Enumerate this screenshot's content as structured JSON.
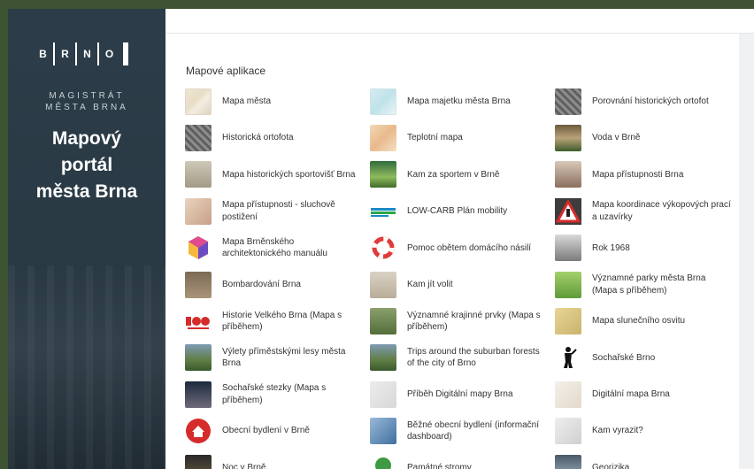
{
  "sidebar": {
    "logo_letters": [
      "B",
      "R",
      "N",
      "O"
    ],
    "magistrat_line1": "MAGISTRÁT",
    "magistrat_line2": "MĚSTA BRNA",
    "title_line1": "Mapový",
    "title_line2": "portál",
    "title_line3": "města Brna"
  },
  "main": {
    "section_title": "Mapové aplikace",
    "apps": [
      {
        "label": "Mapa města",
        "thumb": "map-thumb"
      },
      {
        "label": "Mapa majetku města Brna",
        "thumb": "map-thumb"
      },
      {
        "label": "Porovnání historických ortofot",
        "thumb": "ortho-thumb"
      },
      {
        "label": "Historická ortofota",
        "thumb": "ortho-thumb"
      },
      {
        "label": "Teplotní mapa",
        "thumb": "heat-map-thumb"
      },
      {
        "label": "Voda v Brně",
        "thumb": "water-thumb"
      },
      {
        "label": "Mapa historických sportovišť Brna",
        "thumb": "stadium-thumb"
      },
      {
        "label": "Kam za sportem v Brně",
        "thumb": "sport-thumb"
      },
      {
        "label": "Mapa přístupnosti Brna",
        "thumb": "person-thumb"
      },
      {
        "label": "Mapa přístupnosti - sluchově postižení",
        "thumb": "face-thumb"
      },
      {
        "label": "LOW-CARB Plán mobility",
        "thumb": "lowcarb-logo-thumb"
      },
      {
        "label": "Mapa koordinace výkopových prací a uzavírky",
        "thumb": "roadwork-sign-thumb"
      },
      {
        "label": "Mapa Brněnského architektonického manuálu",
        "thumb": "bam-hexagon-thumb"
      },
      {
        "label": "Pomoc obětem domácího násilí",
        "thumb": "lifebuoy-thumb"
      },
      {
        "label": "Rok 1968",
        "thumb": "old-photo-thumb"
      },
      {
        "label": "Bombardování Brna",
        "thumb": "ruins-thumb"
      },
      {
        "label": "Kam jít volit",
        "thumb": "ballot-thumb"
      },
      {
        "label": "Významné parky města Brna (Mapa s příběhem)",
        "thumb": "park-thumb"
      },
      {
        "label": "Historie Velkého Brna (Mapa s příběhem)",
        "thumb": "velke-brno-logo-thumb"
      },
      {
        "label": "Významné krajinné prvky (Mapa s příběhem)",
        "thumb": "river-thumb"
      },
      {
        "label": "Mapa slunečního osvitu",
        "thumb": "solar-thumb"
      },
      {
        "label": "Výlety příměstskými lesy města Brna",
        "thumb": "forest-thumb"
      },
      {
        "label": "Trips around the suburban forests of the city of Brno",
        "thumb": "forest-thumb"
      },
      {
        "label": "Sochařské Brno",
        "thumb": "statue-thumb"
      },
      {
        "label": "Sochařské stezky (Mapa s příběhem)",
        "thumb": "night-statue-thumb"
      },
      {
        "label": "Příběh Digitální mapy Brna",
        "thumb": "paper-map-thumb"
      },
      {
        "label": "Digitální mapa Brna",
        "thumb": "digital-map-thumb"
      },
      {
        "label": "Obecní bydlení v Brně",
        "thumb": "house-icon-thumb"
      },
      {
        "label": "Běžné obecní bydlení (informační dashboard)",
        "thumb": "dashboard-thumb"
      },
      {
        "label": "Kam vyrazit?",
        "thumb": "kam-vyrazit-thumb"
      },
      {
        "label": "Noc v Brně",
        "thumb": "night-thumb"
      },
      {
        "label": "Památné stromy",
        "thumb": "tree-thumb"
      },
      {
        "label": "Georizika",
        "thumb": "geo-thumb"
      }
    ]
  },
  "colors": {
    "sidebar_bg": "#2b3b47",
    "outer_bg": "#3d5331",
    "content_bg": "#ffffff"
  }
}
